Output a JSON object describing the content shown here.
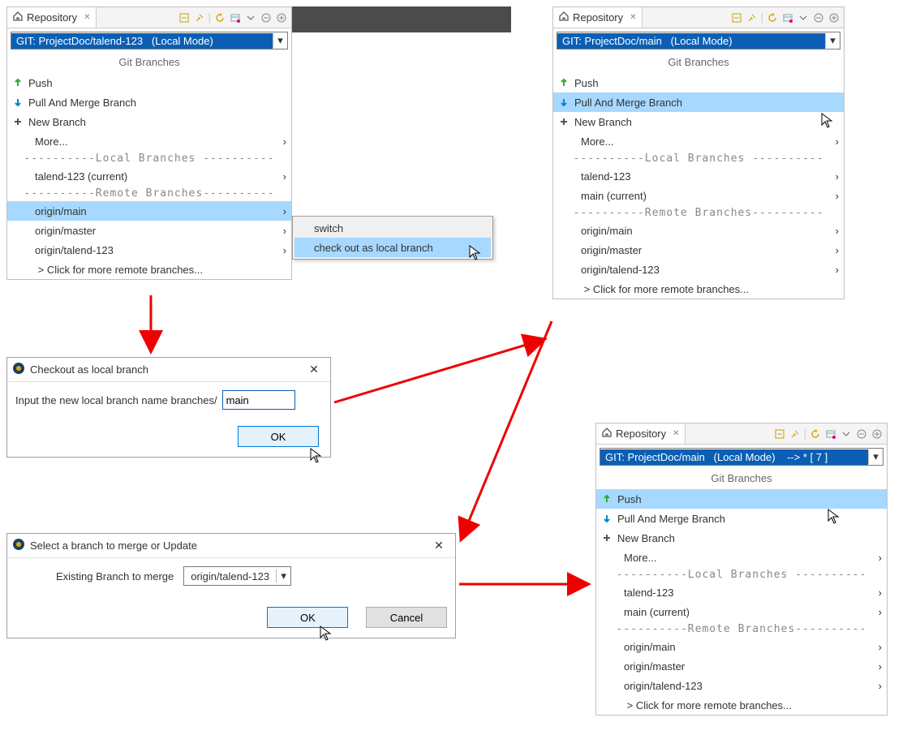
{
  "common": {
    "tab_label": "Repository",
    "section_title": "Git Branches",
    "actions": {
      "push": "Push",
      "pull": "Pull And Merge Branch",
      "new_branch": "New Branch",
      "more": "More..."
    },
    "sep_local": "----------Local  Branches ----------",
    "sep_remote": "----------Remote Branches----------",
    "remote_more": " > Click for more remote branches..."
  },
  "panel1": {
    "header": "GIT: ProjectDoc/talend-123   (Local Mode)",
    "local": [
      "talend-123 (current)"
    ],
    "remote": [
      "origin/main",
      "origin/master",
      "origin/talend-123"
    ],
    "selected_remote": "origin/main",
    "submenu": {
      "switch": "switch",
      "checkout": "check out as local branch"
    }
  },
  "panel2": {
    "header": "GIT: ProjectDoc/main   (Local Mode)",
    "local": [
      "talend-123",
      "main (current)"
    ],
    "remote": [
      "origin/main",
      "origin/master",
      "origin/talend-123"
    ],
    "highlight_action": "pull"
  },
  "panel3": {
    "header": "GIT: ProjectDoc/main   (Local Mode)    --> * [ 7 ]",
    "local": [
      "talend-123",
      "main (current)"
    ],
    "remote": [
      "origin/main",
      "origin/master",
      "origin/talend-123"
    ],
    "highlight_action": "push"
  },
  "dialog_checkout": {
    "title": "Checkout as local branch",
    "prompt": "Input the new local branch name branches/",
    "input_value": "main",
    "ok": "OK"
  },
  "dialog_merge": {
    "title": "Select a branch to merge or Update",
    "label": "Existing Branch to merge",
    "selected": "origin/talend-123",
    "ok": "OK",
    "cancel": "Cancel"
  }
}
